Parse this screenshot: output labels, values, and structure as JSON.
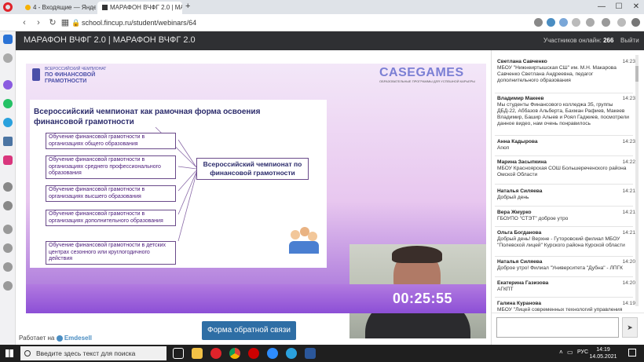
{
  "browser": {
    "tabs": [
      {
        "label": "4 - Входящие — Яндекс.По"
      },
      {
        "label": "МАРАФОН ВЧФГ 2.0 | МАР"
      }
    ],
    "new_tab": "+",
    "url": "school.fincup.ru/student/webinars/64",
    "min": "—",
    "max": "☐",
    "close": "✕"
  },
  "header": {
    "title": "МАРАФОН ВЧФГ 2.0 | МАРАФОН ВЧФГ 2.0",
    "online_label": "Участников онлайн:",
    "online_count": "266",
    "logout": "Выйти"
  },
  "slide": {
    "logo_line1": "ВСЕРОССИЙСКИЙ ЧЕМПИОНАТ",
    "logo_line2": "ПО ФИНАНСОВОЙ",
    "logo_line3": "ГРАМОТНОСТИ",
    "casegames": "CASEGAMES",
    "casegames_sub": "ОБРАЗОВАТЕЛЬНЫЕ ПРОГРАММЫ ДЛЯ УСПЕШНОЙ КАРЬЕРЫ",
    "heading": "Всероссийский чемпионат как рамочная форма освоения финансовой грамотности",
    "boxes": [
      "Обучение финансовой грамотности в организациях общего образования",
      "Обучение финансовой грамотности в организациях среднего профессионального образования",
      "Обучение финансовой грамотности в организациях высшего образования",
      "Обучение финансовой грамотности в организациях дополнительного образования",
      "Обучение финансовой грамотности в детских центрах сезонного или круглогодичного действия"
    ],
    "center": "Всероссийский чемпионат по финансовой грамотности"
  },
  "timer": "00:25:55",
  "feedback_button": "Форма обратной связи",
  "powered": {
    "prefix": "Работает на",
    "brand": "Emdesell"
  },
  "chat": {
    "messages": [
      {
        "name": "Светлана Савченко",
        "time": "14:23",
        "text": "МБОУ \"Нижнеиртышская СШ\" им. М.Н. Макарова Савченко Светлана Андреевна, педагог дополнительного образования"
      },
      {
        "name": "Владимир Макеев",
        "time": "14:23",
        "text": "Мы студенты Финансового колледжа 35, группы ДБД-22, Аббазов Альберта, Бахман Рафиев, Макеев Владимир, Башир Алыев и Роял Гаджиев, посмотрели данное видео, нам очень понравилось"
      },
      {
        "name": "Анна Кадырова",
        "time": "14:23",
        "text": "Агюп"
      },
      {
        "name": "Марина Засыпкина",
        "time": "14:22",
        "text": "МБОУ Красноярская СОШ Большереченского района Омской Области"
      },
      {
        "name": "Наталья Силяева",
        "time": "14:21",
        "text": "Добрый день"
      },
      {
        "name": "Вера Жмурко",
        "time": "14:21",
        "text": "ГБОУПО \"СТЭТ\" доброе утро"
      },
      {
        "name": "Ольга Богданова",
        "time": "14:21",
        "text": "Добрый день! Верхне - Гуторовский филиал МБОУ \"Полевской лицей\" Курского района Курской области"
      },
      {
        "name": "Наталья Силяева",
        "time": "14:20",
        "text": "Доброе утро! Филиал \"Университета \"Дубна\" - ЛПГК"
      },
      {
        "name": "Екатерина Газизова",
        "time": "14:20",
        "text": "АГКПТ"
      },
      {
        "name": "Галина Куранова",
        "time": "14:19",
        "text": "МБОУ \"Лицей современных технологий управления"
      }
    ],
    "send": "➤"
  },
  "taskbar": {
    "search_placeholder": "Введите здесь текст для поиска",
    "lang": "РУС",
    "time": "14:19",
    "date": "14.05.2021"
  }
}
